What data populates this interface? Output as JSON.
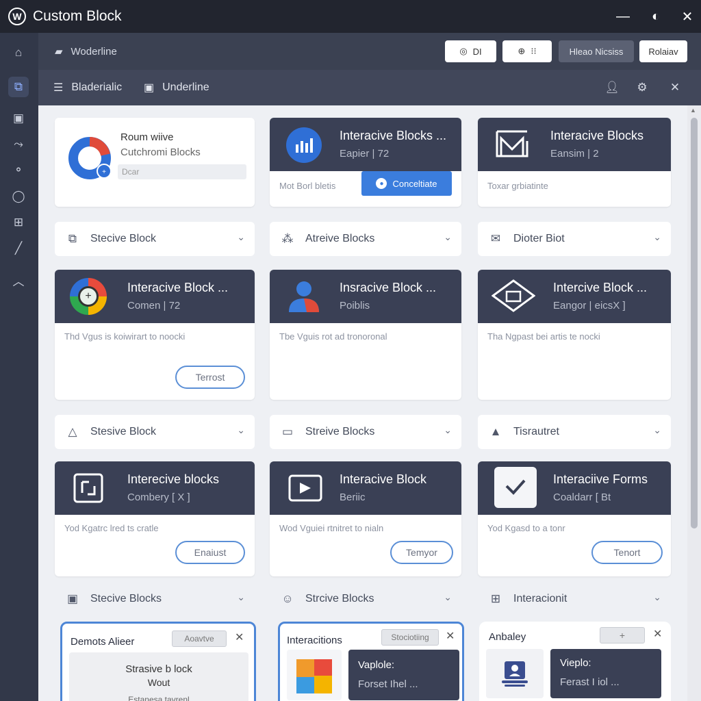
{
  "app": {
    "title": "Custom Block",
    "logo": "W"
  },
  "window": {
    "minimize": "—",
    "theme": "◐",
    "close": "✕"
  },
  "sidebar": {
    "items": [
      {
        "icon": "home-icon",
        "glyph": "⌂"
      },
      {
        "icon": "blocks-icon",
        "glyph": "⧉"
      },
      {
        "icon": "calendar-icon",
        "glyph": "▣"
      },
      {
        "icon": "connect-icon",
        "glyph": "⤳"
      },
      {
        "icon": "share-icon",
        "glyph": "⚬"
      },
      {
        "icon": "chat-icon",
        "glyph": "◯"
      },
      {
        "icon": "grid-icon",
        "glyph": "⊞"
      },
      {
        "icon": "pen-icon",
        "glyph": "╱"
      },
      {
        "icon": "collapse-icon",
        "glyph": "︿"
      }
    ]
  },
  "toolbar1": {
    "label": "Woderline",
    "btn1": "DI",
    "btn2": "⁝⁝",
    "btn3": "Hleao Nicsiss",
    "btn4": "Rolaiav"
  },
  "toolbar2": {
    "item1": "Bladerialic",
    "item2": "Underline"
  },
  "cards": {
    "c1": {
      "title": "Roum wiive",
      "subtitle": "Cutchromi Blocks",
      "input": "Dcar"
    },
    "c2": {
      "title": "Interacive Blocks ...",
      "subtitle": "Eapier | 72",
      "body": "Mot Borl bletis",
      "button": "Conceltiate"
    },
    "c3": {
      "title": "Interacive Blocks",
      "subtitle": "Eansim | 2",
      "body": "Toxar grbiatinte"
    },
    "r2a": {
      "title": "Interacive Block ...",
      "subtitle": "Comen | 72",
      "body": "Thd Vgus is koiwirart to noocki",
      "button": "Terrost"
    },
    "r2b": {
      "title": "Insracive Block ...",
      "subtitle": "Poiblis",
      "body": "Tbe Vguis rot ad tronoronal"
    },
    "r2c": {
      "title": "Intercive Block ...",
      "subtitle": "Eangor | eicsX ]",
      "body": "Tha Ngpast bei artis te nocki"
    },
    "r3a": {
      "title": "Interecive blocks",
      "subtitle": "Combery [ X ]",
      "body": "Yod Kgatrc lred ts cratle",
      "button": "Enaiust"
    },
    "r3b": {
      "title": "Interacive Block",
      "subtitle": "Beriic",
      "body": "Wod Vguiei rtnitret to nialn",
      "button": "Temyor"
    },
    "r3c": {
      "title": "Interaciive Forms",
      "subtitle": "Coaldarr [ Bt",
      "body": "Yod Kgasd to a tonr",
      "button": "Tenort"
    }
  },
  "dropdowns": {
    "d1": "Stecive Block",
    "d2": "Atreive Blocks",
    "d3": "Dioter Biot",
    "d4": "Stesive Block",
    "d5": "Streive Blocks",
    "d6": "Tisrautret",
    "d7": "Stecive Blocks",
    "d8": "Strcive Blocks",
    "d9": "Interacionit"
  },
  "panels": {
    "p1": {
      "title": "Demots Alieer",
      "tag": "Aoavtve",
      "inner_line1": "Strasive b lock",
      "inner_line2": "Wout",
      "footer": "Estanesa tavrenl"
    },
    "p2": {
      "title": "Interacitions",
      "tag": "Stociotiing",
      "inner_line1": "Vaplole:",
      "inner_line2": "Forset Ihel ..."
    },
    "p3": {
      "title": "Anbaley",
      "tag": "+",
      "inner_line1": "Vieplo:",
      "inner_line2": "Ferast I iol ..."
    }
  },
  "colors": {
    "accent": "#4d86d6",
    "header": "#3a4055",
    "chrome": "#22252f"
  }
}
